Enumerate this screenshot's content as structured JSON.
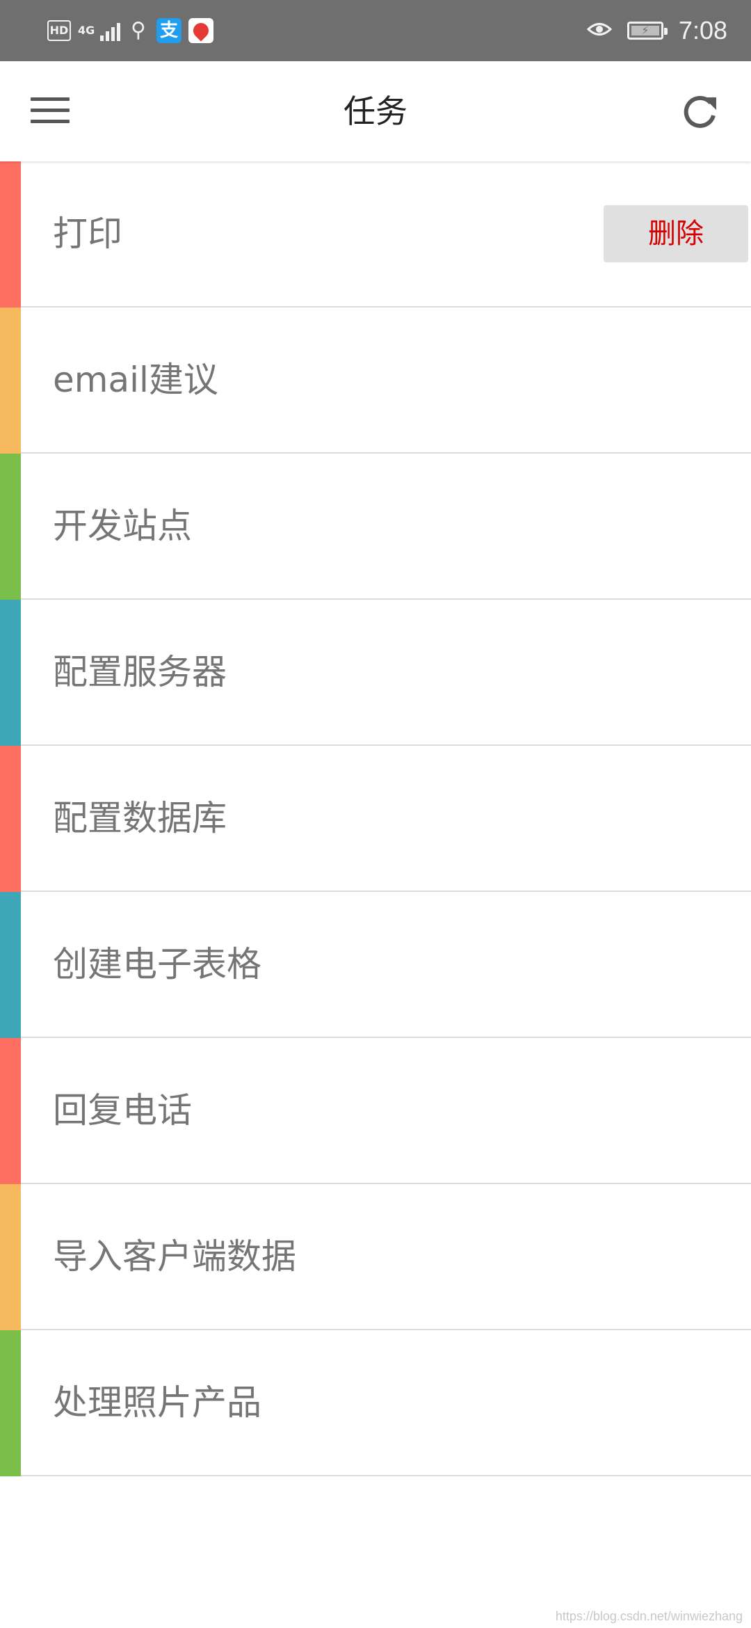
{
  "status_bar": {
    "hd_badge": "HD",
    "network": "4G",
    "usb_icon": "usb-icon",
    "alipay_glyph": "支",
    "time": "7:08"
  },
  "app_bar": {
    "title": "任务",
    "menu_icon": "menu-icon",
    "refresh_icon": "refresh-icon"
  },
  "tasks": [
    {
      "label": "打印",
      "color": "#ff6f61",
      "action_label": "删除"
    },
    {
      "label": "email建议",
      "color": "#f7b95e"
    },
    {
      "label": "开发站点",
      "color": "#7bbf4b"
    },
    {
      "label": "配置服务器",
      "color": "#3fa6b8"
    },
    {
      "label": "配置数据库",
      "color": "#ff6f61"
    },
    {
      "label": "创建电子表格",
      "color": "#3fa6b8"
    },
    {
      "label": "回复电话",
      "color": "#ff6f61"
    },
    {
      "label": "导入客户端数据",
      "color": "#f7b95e"
    },
    {
      "label": "处理照片产品",
      "color": "#7bbf4b"
    }
  ],
  "colors": {
    "delete_text": "#d50000",
    "delete_bg": "#e0e0e0",
    "label_text": "#757575"
  },
  "watermark": "https://blog.csdn.net/winwiezhang"
}
